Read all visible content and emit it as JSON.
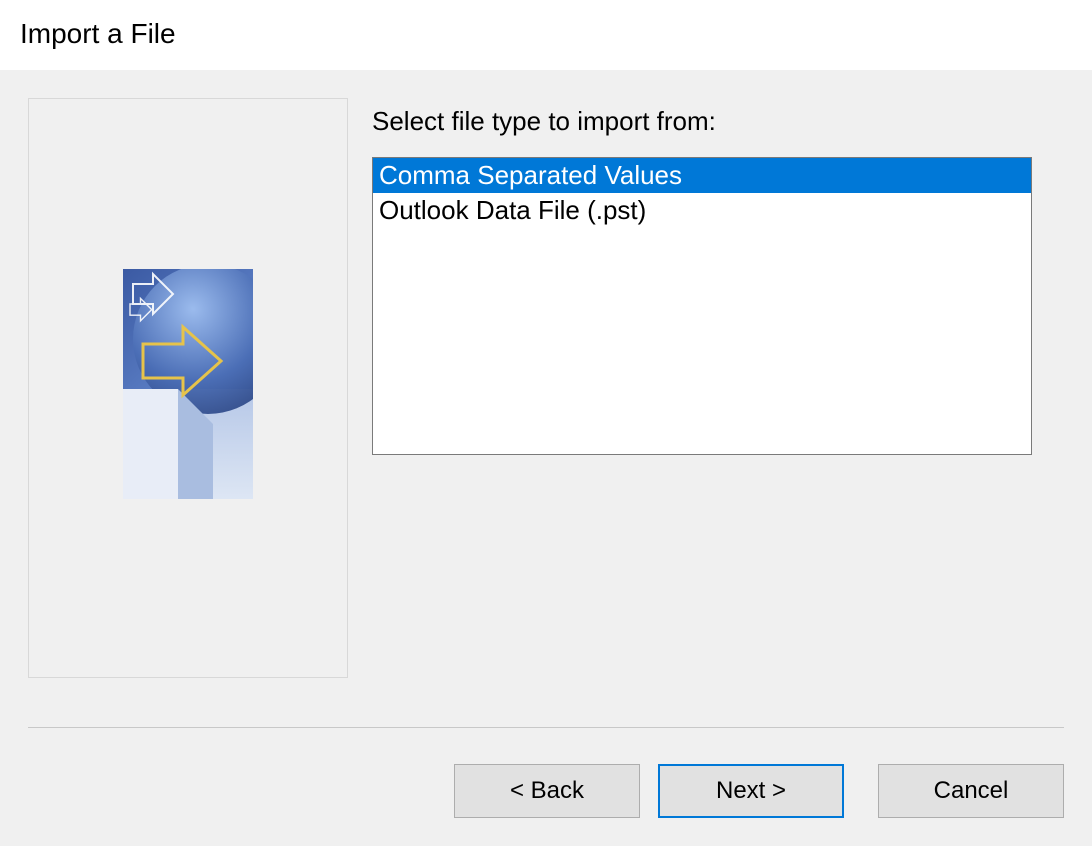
{
  "dialog": {
    "title": "Import a File",
    "instruction": "Select file type to import from:",
    "file_types": [
      {
        "label": "Comma Separated Values",
        "selected": true
      },
      {
        "label": "Outlook Data File (.pst)",
        "selected": false
      }
    ],
    "buttons": {
      "back": "< Back",
      "next": "Next >",
      "cancel": "Cancel"
    }
  }
}
